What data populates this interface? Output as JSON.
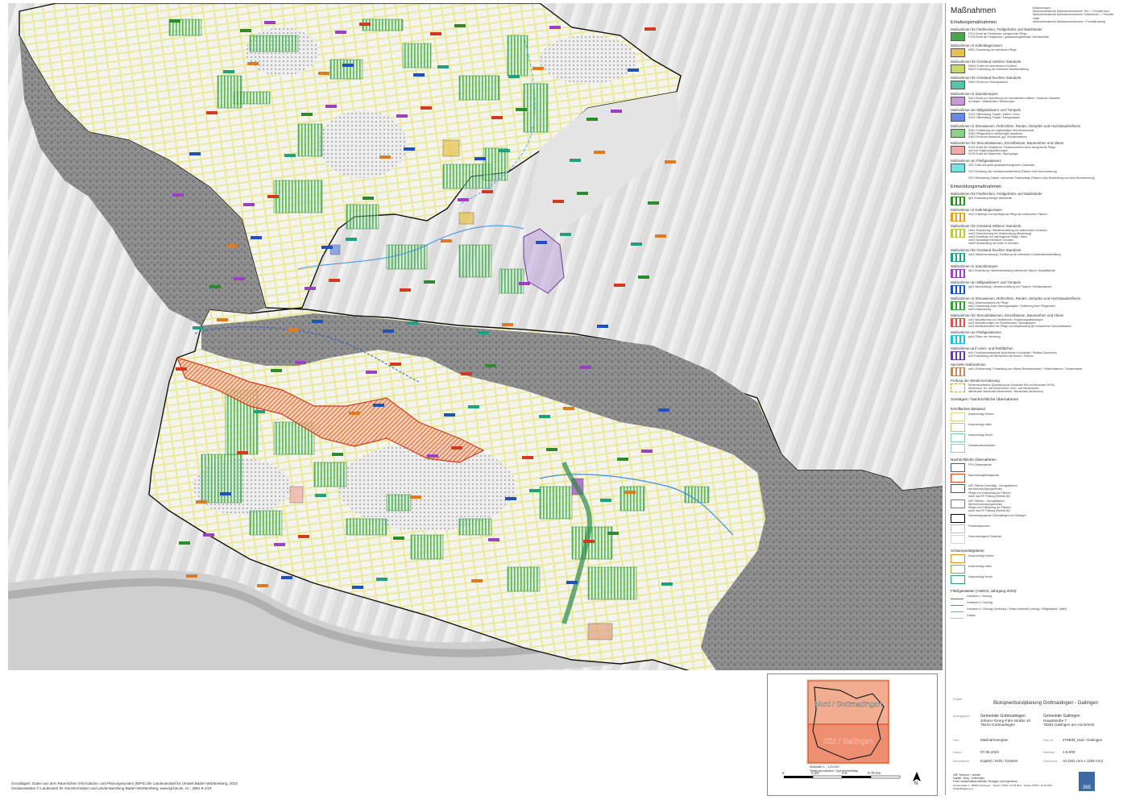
{
  "legend": {
    "title": "Maßnahmen",
    "note": "Erläuterungen:\nMaßnahmenkürzel  Maßnahmennummer Teil / = Priorität hoch\nMaßnahmenkürzel  Maßnahmennummer Seite/kürzel / = Priorität mittel\nMaßnahmenkürzel  Maßnahmennummer = Priorität niedrig",
    "sections": [
      {
        "title": "Erhaltungsmaßnahmen",
        "groups": [
          {
            "title": "Maßnahmen für Feldhecken, Feldgehölze und Waldränder",
            "color": "#4aa84a",
            "style": "fill",
            "text": "FG01  Erhalt der Feldhecken, fachgerechte Pflege\nFG03  Erhalt der Feldgehölze / gewässerbegleitenden Gehölzstreifen"
          },
          {
            "title": "Maßnahmen in Kalk-Magerrasen",
            "color": "#e8c24a",
            "style": "fill",
            "text": "MR01  Fortsetzung der extensiven Pflege"
          },
          {
            "title": "Maßnahmen für Grünland mittlerer Standorte",
            "color": "#c8d86a",
            "style": "fill",
            "text": "MW01  Erhalt von artenreichem Grünland\nMW02  Fortsetzung der extensiven Bewirtschaftung"
          },
          {
            "title": "Maßnahmen für Grünland feuchter Standorte",
            "color": "#5cc0a8",
            "style": "fill",
            "text": "NW01  Erhalt von Feuchtgrünland"
          },
          {
            "title": "Maßnahmen in Saumbiotopen",
            "color": "#c89ad8",
            "style": "fill",
            "text": "SA01  Erhalt und Optimierung von Saumstreifen mittlerer / trockener Standorte\n        an Wegen / Waldrändern / Böschungen"
          },
          {
            "title": "Maßnahmen an Stillgewässern und Tümpeln",
            "color": "#6a8ae0",
            "style": "fill",
            "text": "SG01  Offenhaltung Tümpel / Weiher / Seen\nSG02  Offenhaltung Tümpel / Kleingewässer"
          },
          {
            "title": "Maßnahmen in Streuwiesen, Röhrichten, Rieden, Sümpfen und Hochstaudenfluren",
            "color": "#8ad08a",
            "style": "fill",
            "text": "SW01  Fortsetzung der regelmäßigen Streuwiesenmahd\nSW02  Pflegemahd in mehrjährigen Abständen\nSW03  Erhalt des Bestands, ggf. Gehölzentnahme"
          },
          {
            "title": "Maßnahmen für Streuobstwiesen, Einzelbäume, Baumreihen und Alleen",
            "color": "#f0a8a8",
            "style": "fill",
            "text": "SO01  Erhalt der Obstbäume / Obstbaumreihen durch fachgerechte Pflege\n        und evtl. Ergänzungspflanzungen\nSO02  Erhalt der Baumreihe / Baumgruppe"
          },
          {
            "title": "Maßnahmen an Fließgewässern",
            "color": "#7ae0e0",
            "style": "fill",
            "text": "GE1  Erhalt des guten gewässerökologischen Zustandes\n\nGE2  Einhaltung des Gewässerrandstreifens (Flächen ohne Nummerierung)\n\nGE3  Offenhaltung Gräben, schonende Grabenpflege (Flächen ohne Beschriftung und ohne Nummerierung)"
          }
        ]
      },
      {
        "title": "Entwicklungsmaßnahmen",
        "groups": [
          {
            "title": "Maßnahmen für Feldhecken, Feldgehölze und Waldränder",
            "color": "#2e8a2e",
            "style": "hatch",
            "text": "fg01  Entwicklung stufiger Waldränder"
          },
          {
            "title": "Maßnahmen in Kalk-Magerrasen",
            "color": "#e0a020",
            "style": "hatch",
            "text": "mr01  Erstpflege und nachfolgende Pflege auf entbuschten Flächen"
          },
          {
            "title": "Maßnahmen für Grünland mittlerer Standorte",
            "color": "#b8c840",
            "style": "hatch",
            "text": "mw01  Entwicklung / Wiederherstellung von artenreichem Grünland\nmw02  Extensivierung der Weidenutzung (Beweidung)\nmw03  Erstpflege und nachfolgende Pflege / Mahd\nmw04  Neuanlage extensiver Grünland\nmw05  Umwandlung von Acker in Grünland"
          },
          {
            "title": "Maßnahmen für Grünland feuchter Standorte",
            "color": "#20a080",
            "style": "hatch",
            "text": "nw01  Wiedervernässung / Einführung der extensiven Grünlandbewirtschaftung"
          },
          {
            "title": "Maßnahmen in Saumbiotopen",
            "color": "#9a40c0",
            "style": "hatch",
            "text": "sa01  Entwicklung / Wiederherstellung artenreicher Säume / Ansaatflächen"
          },
          {
            "title": "Maßnahmen an Stillgewässern und Tümpeln",
            "color": "#2050c0",
            "style": "hatch",
            "text": "sg02  Neuschaffung / Wiederherstellung von Tümpeln / Kleingewässern"
          },
          {
            "title": "Maßnahmen in Streuwiesen, Röhrichten, Rieden, Sümpfen und Hochstaudenfluren",
            "color": "#30a030",
            "style": "hatch",
            "text": "sw01  Wiederaufnahme der Pflege\nsw02  Entwicklung durch Nutzungsaufgabe / Einführung einer Pflegemahd\nsw03  Entbuschung"
          },
          {
            "title": "Maßnahmen für Streuobstwiesen, Einzelbäume, Baumreihen und Alleen",
            "color": "#e05050",
            "style": "hatch",
            "text": "so01  Neupflanzung von Obstbäumen / Ergänzungspflanzungen\nso02  Neupflanzungen von Einzelbäumen / Baumgruppen\nso03  Wiederaufnahme der Pflege und Neupflanzung auf vorhandenen Streuobstwiesen"
          },
          {
            "title": "Maßnahmen an Fließgewässern",
            "color": "#20c0d0",
            "style": "hatch",
            "text": "ge04  Öffnen der Verdolung"
          },
          {
            "title": "Maßnahmen auf Acker- und Rebflächen",
            "color": "#6a3aa0",
            "style": "hatch",
            "text": "ar01  Produktionsintegrierte Maßnahmen in Ackerbau / Rebbau (Suchraum)\nar02  Entwicklung von Blühstreifen auf Äckern / Rebbau"
          },
          {
            "title": "Spezielle Maßnahmen",
            "color": "#c08a60",
            "style": "hatch",
            "text": "sm01  Entbuschung / Freistellung von offenen Bodenstrukturen / Felsformationen / Trockenmauer"
          },
          {
            "title": "Prüfung der Wiedervernässung",
            "color": "#b8a050",
            "style": "dashed",
            "text": "Niedermoorflächen (Darstellung der Moorkarte BW und Moorkarte SKS9),\nNiedermoor, An- und Niedermoore, Hoch- und Niedermoore,\naltkolluviale überdeckte Niedermoore, überdecktes Niedermoor)"
          }
        ]
      }
    ],
    "other_title": "Sonstiges / Nachrichtliche Übernahmen",
    "kernflaechen_title": "Kernflächen Bestand",
    "kernflaechen": [
      {
        "label": "Anspruchstyp trocken",
        "color": "#e8d080"
      },
      {
        "label": "Anspruchstyp mittel",
        "color": "#b0d070"
      },
      {
        "label": "Anspruchstyp feucht",
        "color": "#80c8b0"
      },
      {
        "label": "Gewässerlandschaften",
        "color": "#90c8e8"
      }
    ],
    "nachrichtlich_title": "Nachrichtliche Übernahmen",
    "nachrichtlich": [
      {
        "label": "FFH-Gebietsgrenze",
        "color": "#3060c0"
      },
      {
        "label": "Naturschutzgebietsgrenze",
        "color": "#e04020"
      },
      {
        "label": "ASP-Flächen (Vorzeitig) - Vorzugsflächen\ndes Artenschutzprogrammes\nPflege und Entwicklung der Flächen\ndurch das RP Freiburg (Referat 56)",
        "color": "#555555"
      },
      {
        "label": "ASP-Flächen - Vorzugsflächen\ndes Artenschutzprogrammes\nPflege und Entwicklung der Flächen\ndurch das RP Freiburg (Referat 56)",
        "color": "#777777"
      },
      {
        "label": "Gemarkungsgrenze Gottmadingen und Gailingen",
        "color": "#000000"
      },
      {
        "label": "Flurstücksgrenzen",
        "color": "#c0c0c0"
      },
      {
        "label": "Gemeindeeigene Flurstücke",
        "color": "#cfd6cf"
      }
    ],
    "schwerpunkt_title": "Schwerpunktgebiete",
    "schwerpunkt": [
      {
        "label": "Anspruchstyp trocken",
        "color": "#e09020"
      },
      {
        "label": "Anspruchstyp mittel",
        "color": "#90b020"
      },
      {
        "label": "Anspruchstyp feucht",
        "color": "#20a080"
      }
    ],
    "fliess_title": "Fließgewässer (AWGN, Jahrgang 2023)",
    "fliess": [
      {
        "label": "Gewässer I. Ordnung",
        "color": "#4070d0"
      },
      {
        "label": "Gewässer II. Ordnung",
        "color": "#4090e0"
      },
      {
        "label": "Gewässer II. Ordnung (Verdolung / Verlauf innerhalb (Leitung) / Stillgewässer / Wald)",
        "color": "#60b0e8"
      },
      {
        "label": "Gräben",
        "color": "#90d0f0"
      }
    ]
  },
  "title_block": {
    "projekt_label": "Projekt",
    "projekt": "Biotopverbundplanung Gottmadingen - Gailingen",
    "auftraggeber_label": "Auftraggeber",
    "client1": [
      "Gemeinde Gottmadingen",
      "Johann-Georg-Fahr-Straße 10",
      "78244 Gottmadingen"
    ],
    "client2": [
      "Gemeinde Gailingen",
      "Hauptstraße 7",
      "78262 Gailingen am Hochrhein"
    ],
    "plan_label": "Plan",
    "plan": "Maßnahmenplan",
    "plannr_label": "Plan-Nr.",
    "plannr": "2785/M_Süd / Gailingen",
    "datum_label": "Datum",
    "datum": "07.06.2024",
    "massstab_label": "Maßstab",
    "massstab": "1:9.000",
    "bearbeiter_label": "Bearbeiter/in",
    "bearbeiter": "Kapitel / Kühl / Küsters",
    "format_label": "Planformat",
    "format": "A0 (841 mm x 1189 mm)",
    "company": "365° freiraum + umwelt\nKapitel · Beig · Kellermann\nFreie Landschaftsarchitekten, Biologen und Ingenieure",
    "address": "Klosterstraße 1 · 88662 Überlingen · Telefon 07551 / 94 95 58-0 · Telefax 07551 / 94 95 58-9 · info@365grad.com",
    "logo": "365"
  },
  "inset": {
    "north_label": "Nord / Gottmadingen",
    "south_label": "Süd / Gailingen",
    "caption": "Maßstab 1 : 125.000\nHintergrundkarte: OpenStreetMap"
  },
  "scalebar": {
    "ticks": [
      "0",
      "0,25",
      "0,5",
      "0,75 km"
    ],
    "north": "N"
  },
  "credits": "Grundlagen: Daten aus dem Räumlichen Informations- und Planungssystem (RIPS) der Landesanstalt für Umwelt Baden-Württemberg, 2023\nGeobasisdaten © Landesamt für Geoinformation und Landentwicklung Baden-Württemberg, www.lgl-bw.de, Az.: 2851.9-1/19"
}
